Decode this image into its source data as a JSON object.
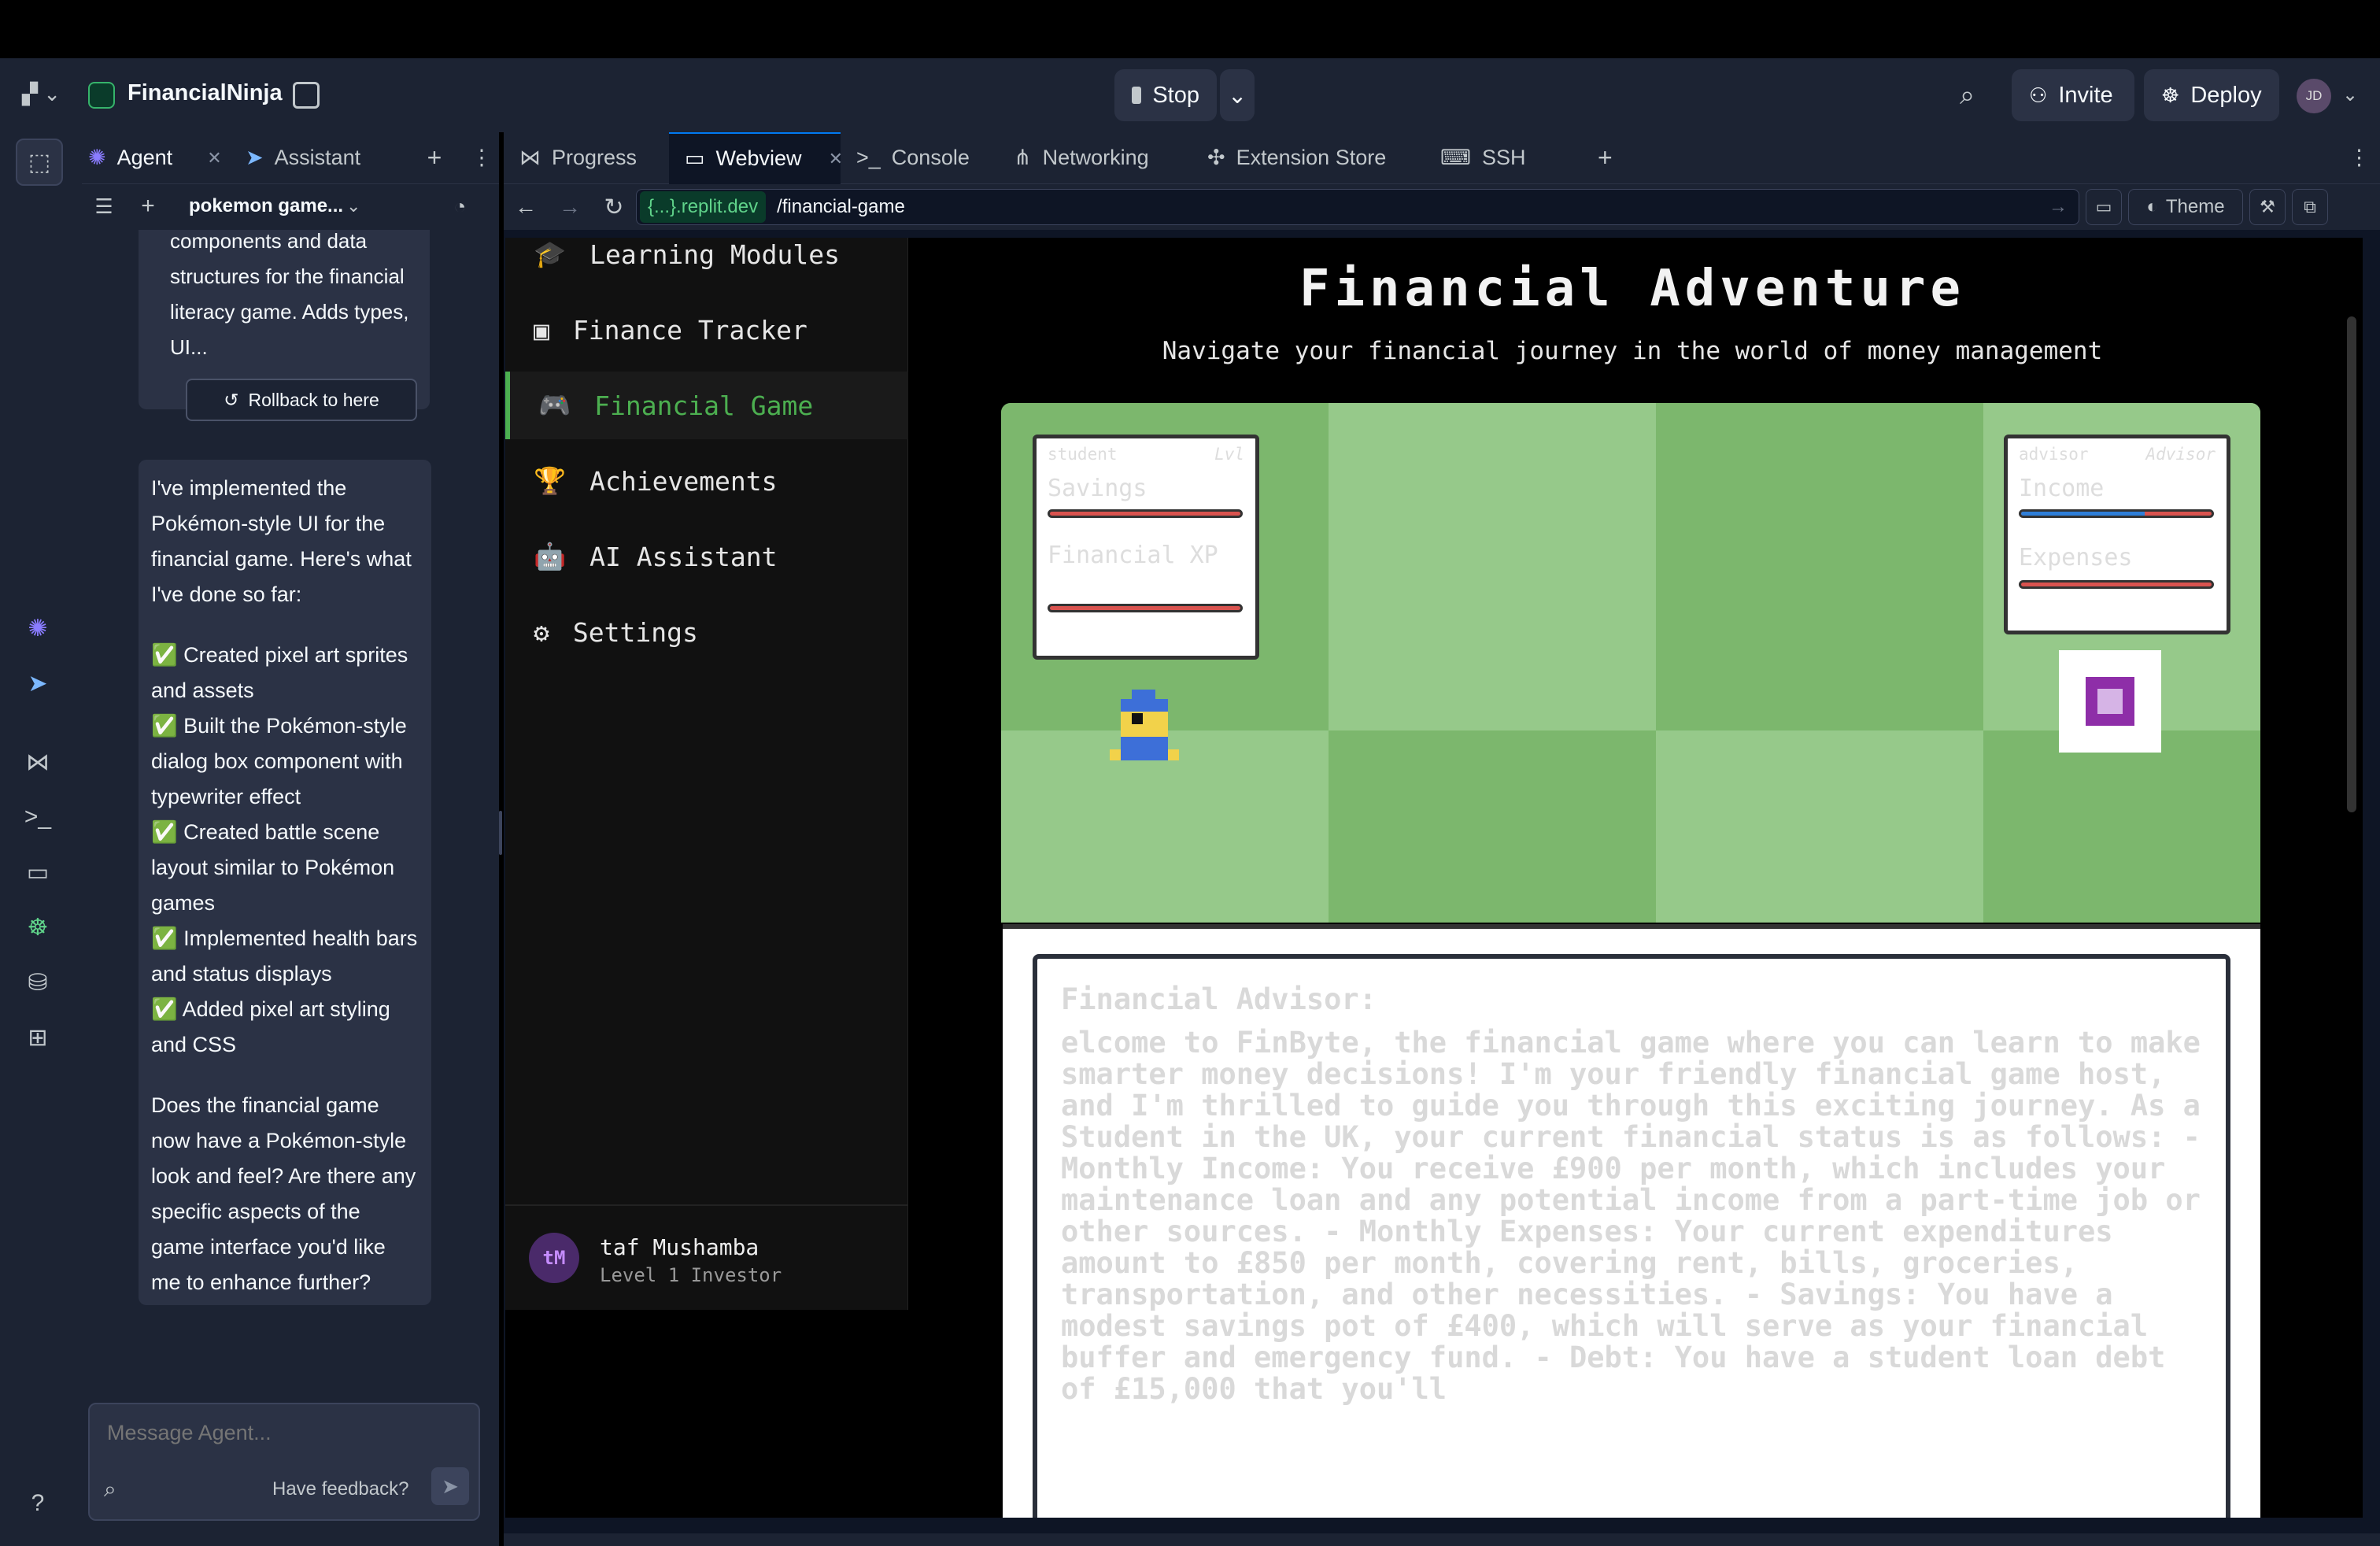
{
  "topbar": {
    "project_name": "FinancialNinja",
    "stop_label": "Stop",
    "invite_label": "Invite",
    "deploy_label": "Deploy",
    "avatar_initials": "JD"
  },
  "agent_panel": {
    "tabs": [
      {
        "label": "Agent"
      },
      {
        "label": "Assistant"
      }
    ],
    "thread_title": "pokemon game...",
    "checkpoint_text": "components and data structures for the financial literacy game. Adds types, UI...",
    "rollback_label": "Rollback to here",
    "message": {
      "intro": "I've implemented the Pokémon-style UI for the financial game. Here's what I've done so far:",
      "items": [
        "✅ Created pixel art sprites and assets",
        "✅ Built the Pokémon-style dialog box component with typewriter effect",
        "✅ Created battle scene layout similar to Pokémon games",
        "✅ Implemented health bars and status displays",
        "✅ Added pixel art styling and CSS"
      ],
      "question": "Does the financial game now have a Pokémon-style look and feel? Are there any specific aspects of the game interface you'd like me to enhance further?"
    },
    "input_placeholder": "Message Agent...",
    "feedback_label": "Have feedback?"
  },
  "right_tabs": [
    {
      "label": "Progress"
    },
    {
      "label": "Webview"
    },
    {
      "label": "Console"
    },
    {
      "label": "Networking"
    },
    {
      "label": "Extension Store"
    },
    {
      "label": "SSH"
    }
  ],
  "urlbar": {
    "domain": "{...}.replit.dev",
    "path": "/financial-game",
    "theme_label": "Theme"
  },
  "app": {
    "nav": [
      {
        "label": "Learning Modules",
        "icon": "graduation-cap-icon"
      },
      {
        "label": "Finance Tracker",
        "icon": "wallet-icon"
      },
      {
        "label": "Financial Game",
        "icon": "gamepad-icon"
      },
      {
        "label": "Achievements",
        "icon": "trophy-icon"
      },
      {
        "label": "AI Assistant",
        "icon": "robot-icon"
      },
      {
        "label": "Settings",
        "icon": "gear-icon"
      }
    ],
    "user": {
      "initials": "tM",
      "name": "taf Mushamba",
      "level": "Level 1 Investor"
    },
    "title": "Financial Adventure",
    "subtitle": "Navigate your financial journey in the world of money management",
    "player": {
      "name": "student",
      "level": "Lvl",
      "stat1": "Savings",
      "stat2": "Financial XP"
    },
    "opponent": {
      "name": "advisor",
      "type": "Advisor",
      "stat1": "Income",
      "stat2": "Expenses"
    },
    "income_bar_fraction": 0.65,
    "dialog": {
      "speaker": "Financial Advisor:",
      "text": "elcome to FinByte, the financial game where you can learn to make smarter money decisions! I'm your friendly financial game host, and I'm thrilled to guide you through this exciting journey. As a Student in the UK, your current financial status is as follows: - Monthly Income: You receive £900 per month, which includes your maintenance loan and any potential income from a part-time job or other sources. - Monthly Expenses: Your current expenditures amount to £850 per month, covering rent, bills, groceries, transportation, and other necessities. - Savings: You have a modest savings pot of £400, which will serve as your financial buffer and emergency fund. - Debt: You have a student loan debt of £15,000 that you'll"
    }
  },
  "colors": {
    "accent_green": "#4caf50",
    "grass": "#7cb76d",
    "grass_light": "#96c98a",
    "hp_red": "#d9534f",
    "hp_blue": "#2f7fd8"
  }
}
